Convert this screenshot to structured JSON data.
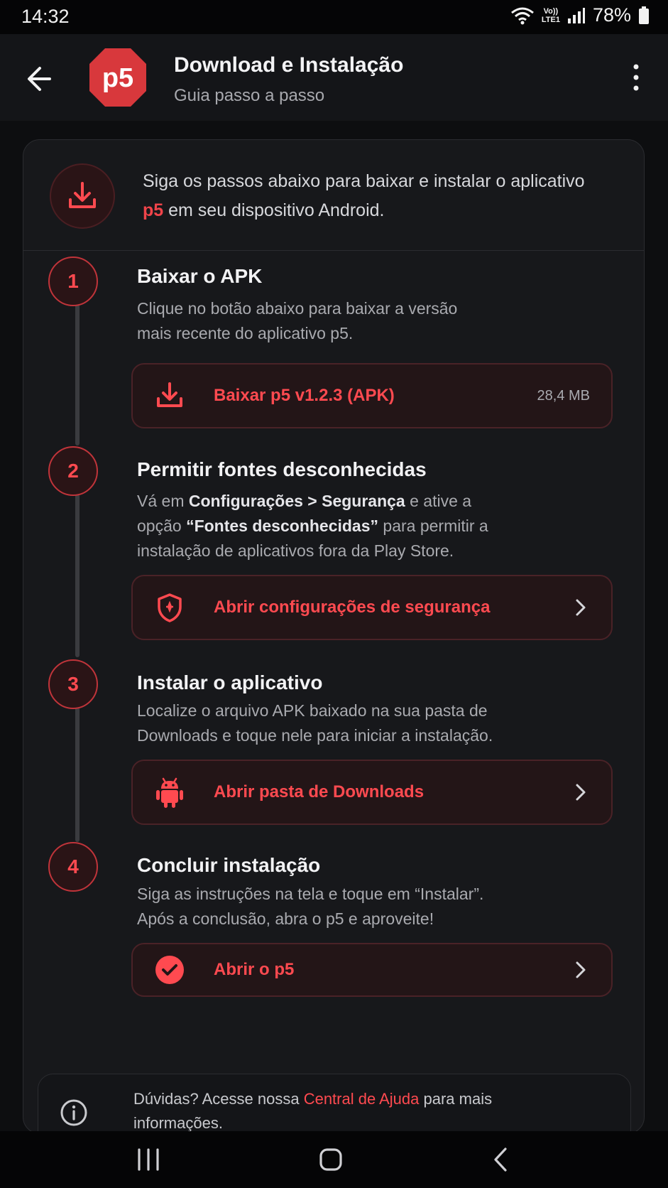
{
  "status_bar": {
    "time": "14:32",
    "network_top": "Vo))",
    "network_bottom": "LTE1",
    "battery": "78%"
  },
  "app_bar": {
    "logo_text": "p5",
    "title": "Download e Instalação",
    "subtitle": "Guia passo a passo"
  },
  "intro": {
    "text_before": "Siga os passos abaixo para baixar e instalar o aplicativo ",
    "highlight": "p5",
    "text_after": " em seu dispositivo Android."
  },
  "steps": [
    {
      "number": "1",
      "title": "Baixar o APK",
      "desc": "Clique no botão abaixo para baixar a versão mais recente do aplicativo p5.",
      "action_label": "Baixar p5 v1.2.3 (APK)",
      "action_size": "28,4 MB"
    },
    {
      "number": "2",
      "title": "Permitir fontes desconhecidas",
      "desc_before": "Vá em ",
      "desc_bold1": "Configurações > Segurança",
      "desc_mid": " e ative a opção ",
      "desc_bold2": "“Fontes desconhecidas”",
      "desc_after": " para permitir a instalação de aplicativos fora da Play Store.",
      "action_label": "Abrir configurações de segurança"
    },
    {
      "number": "3",
      "title": "Instalar o aplicativo",
      "desc": "Localize o arquivo APK baixado na sua pasta de Downloads e toque nele para iniciar a instalação.",
      "action_label": "Abrir pasta de Downloads"
    },
    {
      "number": "4",
      "title": "Concluir instalação",
      "desc": "Siga as instruções na tela e toque em “Instalar”. Após a conclusão, abra o p5 e aproveite!",
      "action_label": "Abrir o p5"
    }
  ],
  "help": {
    "text_before": "Dúvidas? Acesse nossa ",
    "link": "Central de Ajuda",
    "text_after": " para mais informações."
  },
  "colors": {
    "accent": "#f0444a",
    "background": "#0d0e10",
    "card": "#17181b"
  }
}
